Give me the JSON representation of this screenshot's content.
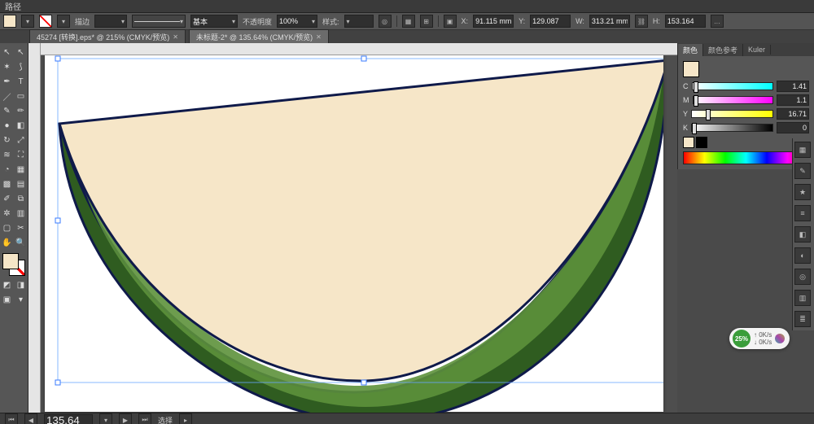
{
  "menubar": {
    "path_label": "路径"
  },
  "controlbar": {
    "fill_label": "描边",
    "stroke_weight": "",
    "stroke_style": "基本",
    "opacity_label": "不透明度",
    "opacity_value": "100%",
    "style_label": "样式:",
    "x_label": "X:",
    "x_value": "91.115 mm",
    "y_label": "Y:",
    "y_value": "129.087",
    "w_label": "W:",
    "w_value": "313.21 mm",
    "h_label": "H:",
    "h_value": "153.164"
  },
  "tabs": [
    {
      "label": "45274 [转换].eps* @ 215% (CMYK/预览)",
      "active": false
    },
    {
      "label": "未标题-2* @ 135.64% (CMYK/预览)",
      "active": true
    }
  ],
  "artwork": {
    "fill_color": "#f6e6c8",
    "rind_dark": "#2e5a1e",
    "rind_light": "#5a8f3a",
    "stroke": "#0f1a4a"
  },
  "color_panel": {
    "tab1": "颜色",
    "tab2": "颜色参考",
    "tab3": "Kuler",
    "c": {
      "label": "C",
      "value": "1.41"
    },
    "m": {
      "label": "M",
      "value": "1.1"
    },
    "y": {
      "label": "Y",
      "value": "16.71"
    },
    "k": {
      "label": "K",
      "value": "0"
    }
  },
  "status": {
    "zoom": "135.64",
    "tool_label": "选择"
  },
  "badge": {
    "pct": "25%",
    "line1": "0K/s",
    "line2": "0K/s"
  }
}
